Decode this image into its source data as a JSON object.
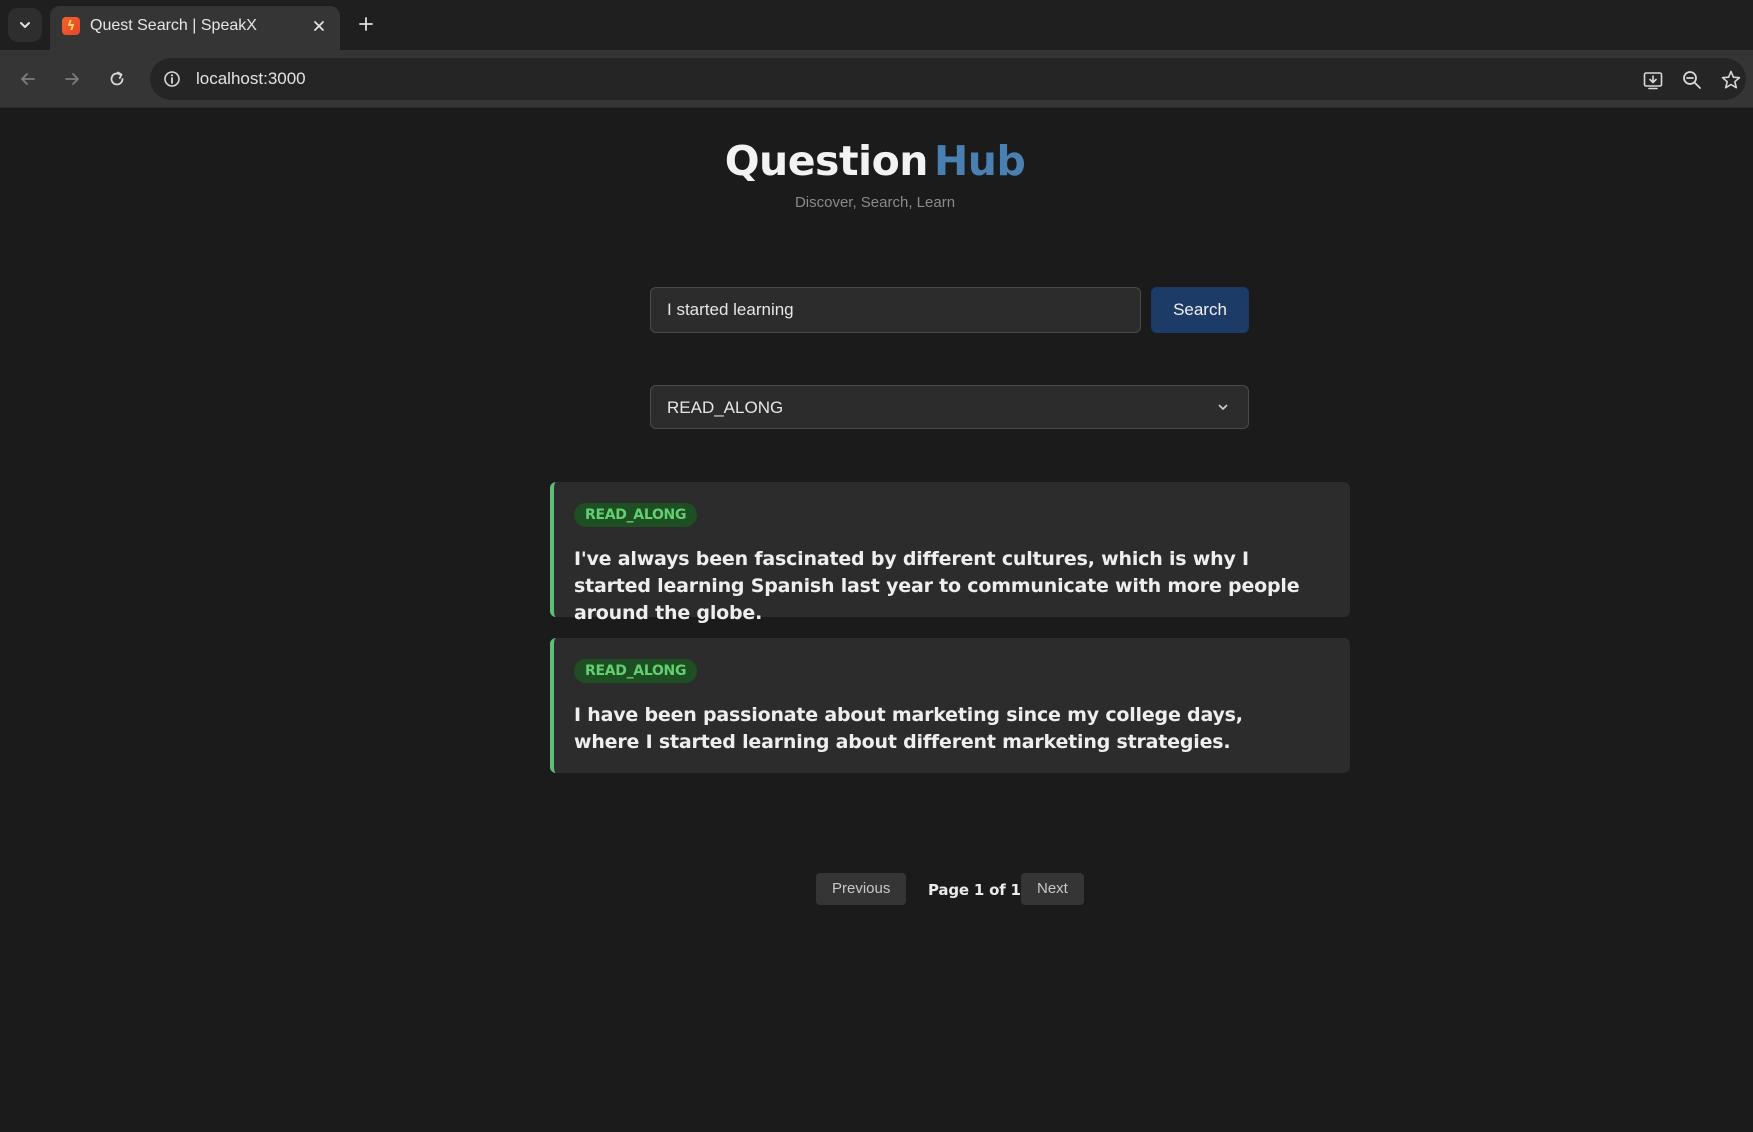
{
  "browser": {
    "tab": {
      "title": "Quest Search | SpeakX"
    },
    "address_bar": {
      "url": "localhost:3000"
    }
  },
  "header": {
    "title_part1": "Question",
    "title_part2": "Hub",
    "tagline": "Discover, Search, Learn"
  },
  "search": {
    "value": "I started learning",
    "button_label": "Search"
  },
  "filter": {
    "selected": "READ_ALONG"
  },
  "results": [
    {
      "type": "READ_ALONG",
      "text": "I've always been fascinated by different cultures, which is why I started learning Spanish last year to communicate with more people around the globe."
    },
    {
      "type": "READ_ALONG",
      "text": "I have been passionate about marketing since my college days, where I started learning about different marketing strategies."
    }
  ],
  "pagination": {
    "previous_label": "Previous",
    "page_info": "Page 1 of 1",
    "next_label": "Next"
  },
  "colors": {
    "background": "#1b1b1b",
    "accent_blue": "#4a7fb1",
    "button_blue": "#1c3b66",
    "badge_green": "#63cf72",
    "card_border_green": "#5fbf7a"
  }
}
